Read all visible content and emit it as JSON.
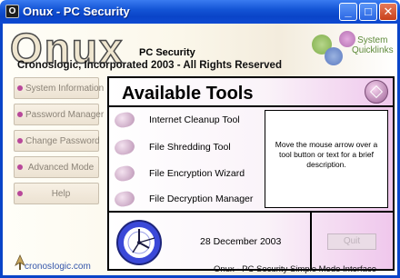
{
  "window": {
    "title": "Onux - PC Security",
    "icon_name": "onux-app-icon",
    "minimize_glyph": "_",
    "maximize_glyph": "□",
    "close_glyph": "✕"
  },
  "header": {
    "logo_text": "Onux",
    "product_name": "PC Security",
    "copyright": "Cronoslogic, Incorporated 2003 - All Rights Reserved",
    "quicklinks_line1": "System",
    "quicklinks_line2": "Quicklinks"
  },
  "nav": {
    "items": [
      {
        "label": "System Information"
      },
      {
        "label": "Password Manager"
      },
      {
        "label": "Change Password"
      },
      {
        "label": "Advanced Mode"
      },
      {
        "label": "Help"
      }
    ]
  },
  "panel": {
    "title": "Available Tools",
    "tools": [
      {
        "label": "Internet Cleanup Tool"
      },
      {
        "label": "File Shredding Tool"
      },
      {
        "label": "File Encryption Wizard"
      },
      {
        "label": "File Decryption Manager"
      }
    ],
    "description": "Move the mouse arrow over a tool button or text for a brief description.",
    "date": "28 December 2003",
    "quit_label": "Quit"
  },
  "footer": {
    "brand": "cronosIogic.com",
    "status": "Onux - PC Security Simple Mode Interface"
  },
  "colors": {
    "titlebar": "#0a44c8",
    "nav_dot": "#b8489a",
    "panel_pink": "#efc7ec",
    "link_blue": "#3355aa"
  }
}
